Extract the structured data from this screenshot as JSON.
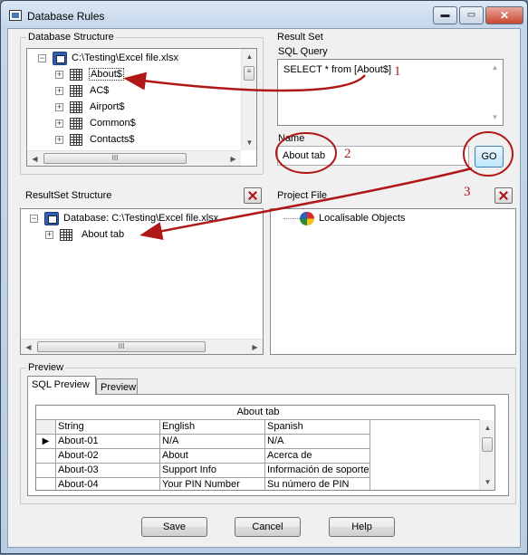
{
  "window": {
    "title": "Database Rules"
  },
  "caption_buttons": {
    "minimize": "▬",
    "maximize": "▭",
    "close": "✕"
  },
  "db_structure": {
    "label": "Database Structure",
    "root": "C:\\Testing\\Excel file.xlsx",
    "items": [
      "About$",
      "AC$",
      "Airport$",
      "Common$",
      "Contacts$"
    ]
  },
  "result_set": {
    "label": "Result Set",
    "sql_label": "SQL Query",
    "sql_value": "SELECT * from [About$]",
    "name_label": "Name",
    "name_value": "About tab",
    "go_label": "GO"
  },
  "resultset_structure": {
    "label": "ResultSet Structure",
    "root": "Database: C:\\Testing\\Excel file.xlsx",
    "items": [
      "About tab"
    ]
  },
  "project_file": {
    "label": "Project File",
    "root": "Localisable Objects"
  },
  "preview": {
    "label": "Preview",
    "tabs": [
      "SQL Preview",
      "Preview"
    ],
    "table_title": "About tab",
    "columns": [
      "String",
      "English",
      "Spanish"
    ],
    "rows": [
      [
        "About-01",
        "N/A",
        "N/A"
      ],
      [
        "About-02",
        "About",
        "Acerca de"
      ],
      [
        "About-03",
        "Support Info",
        "Información de soporte"
      ],
      [
        "About-04",
        "Your PIN Number",
        "Su número de PIN"
      ]
    ]
  },
  "buttons": {
    "save": "Save",
    "cancel": "Cancel",
    "help": "Help"
  },
  "annotations": [
    "1",
    "2",
    "3"
  ],
  "colors": {
    "annotation": "#b01818",
    "accent": "#2f5fb0"
  }
}
